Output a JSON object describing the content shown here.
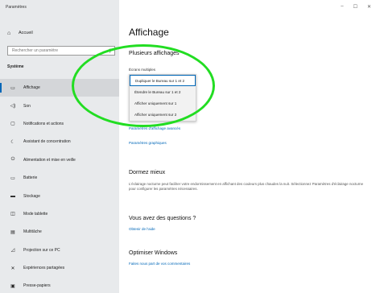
{
  "window": {
    "app_title": "Paramètres",
    "controls": [
      "–",
      "☐",
      "✕"
    ]
  },
  "sidebar": {
    "home_label": "Accueil",
    "search_placeholder": "Rechercher un paramètre",
    "section_label": "Système",
    "items": [
      {
        "icon": "monitor-icon",
        "glyph": "▭",
        "label": "Affichage",
        "selected": true
      },
      {
        "icon": "sound-icon",
        "glyph": "◁)",
        "label": "Son"
      },
      {
        "icon": "notifications-icon",
        "glyph": "▢",
        "label": "Notifications et actions"
      },
      {
        "icon": "focus-assist-icon",
        "glyph": "☾",
        "label": "Assistant de concentration"
      },
      {
        "icon": "power-icon",
        "glyph": "⏻",
        "label": "Alimentation et mise en veille"
      },
      {
        "icon": "battery-icon",
        "glyph": "▭",
        "label": "Batterie"
      },
      {
        "icon": "storage-icon",
        "glyph": "▬",
        "label": "Stockage"
      },
      {
        "icon": "tablet-mode-icon",
        "glyph": "◫",
        "label": "Mode tablette"
      },
      {
        "icon": "multitasking-icon",
        "glyph": "▤",
        "label": "Multitâche"
      },
      {
        "icon": "projection-icon",
        "glyph": "◿",
        "label": "Projection sur ce PC"
      },
      {
        "icon": "shared-experiences-icon",
        "glyph": "✕",
        "label": "Expériences partagées"
      },
      {
        "icon": "clipboard-icon",
        "glyph": "▣",
        "label": "Presse-papiers"
      }
    ]
  },
  "main": {
    "title": "Affichage",
    "multiple_displays": {
      "heading": "Plusieurs affichages",
      "label": "Écrans multiples",
      "options": [
        "Dupliquer le Bureau sur 1 et 2",
        "Étendre le Bureau sur 1 et 2",
        "Afficher uniquement sur 1",
        "Afficher uniquement sur 2"
      ],
      "selected_index": 0,
      "advanced_link": "Paramètres d'affichage avancés",
      "graphics_link": "Paramètres graphiques"
    },
    "sleep_better": {
      "heading": "Dormez mieux",
      "description": "L'éclairage nocturne peut faciliter votre endormissement en affichant des couleurs plus chaudes la nuit. Sélectionnez Paramètres d'éclairage nocturne pour configurer les paramètres nécessaires."
    },
    "questions": {
      "heading": "Vous avez des questions ?",
      "link": "Obtenir de l'aide"
    },
    "optimize": {
      "heading": "Optimiser Windows",
      "link": "Faites nous part de vos commentaires"
    }
  },
  "colors": {
    "accent": "#0067b8",
    "annotation": "#22dd22",
    "sidebar_bg": "#e8eaec"
  }
}
